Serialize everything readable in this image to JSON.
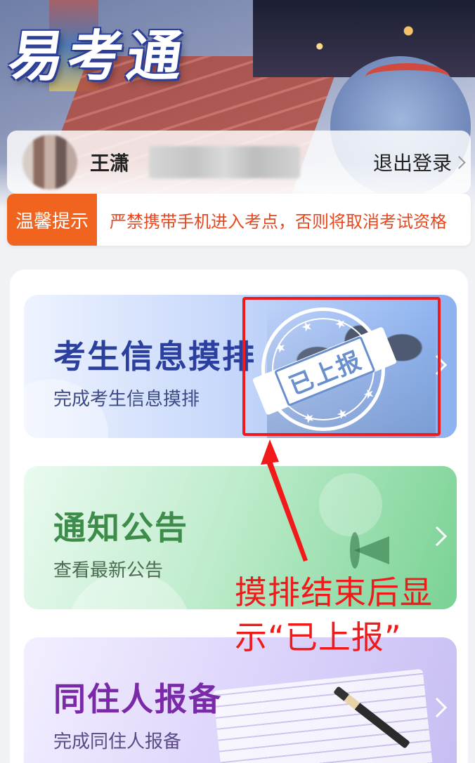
{
  "app": {
    "title": "易考通"
  },
  "user": {
    "name": "王潇",
    "logout_label": "退出登录"
  },
  "notice": {
    "tag": "温馨提示",
    "text": "严禁携带手机进入考点，否则将取消考试资格"
  },
  "cards": [
    {
      "title": "考生信息摸排",
      "subtitle": "完成考生信息摸排",
      "stamp": "已上报"
    },
    {
      "title": "通知公告",
      "subtitle": "查看最新公告"
    },
    {
      "title": "同住人报备",
      "subtitle": "完成同住人报备"
    }
  ],
  "annotation": {
    "text": "摸排结束后显示“已上报”"
  },
  "colors": {
    "notice_tag": "#f06420",
    "notice_text": "#e8481f",
    "card_info_title": "#2a3f9e",
    "card_notice_title": "#3d8c4a",
    "card_cohab_title": "#7a2aa8",
    "annotation": "#f01a1a"
  }
}
